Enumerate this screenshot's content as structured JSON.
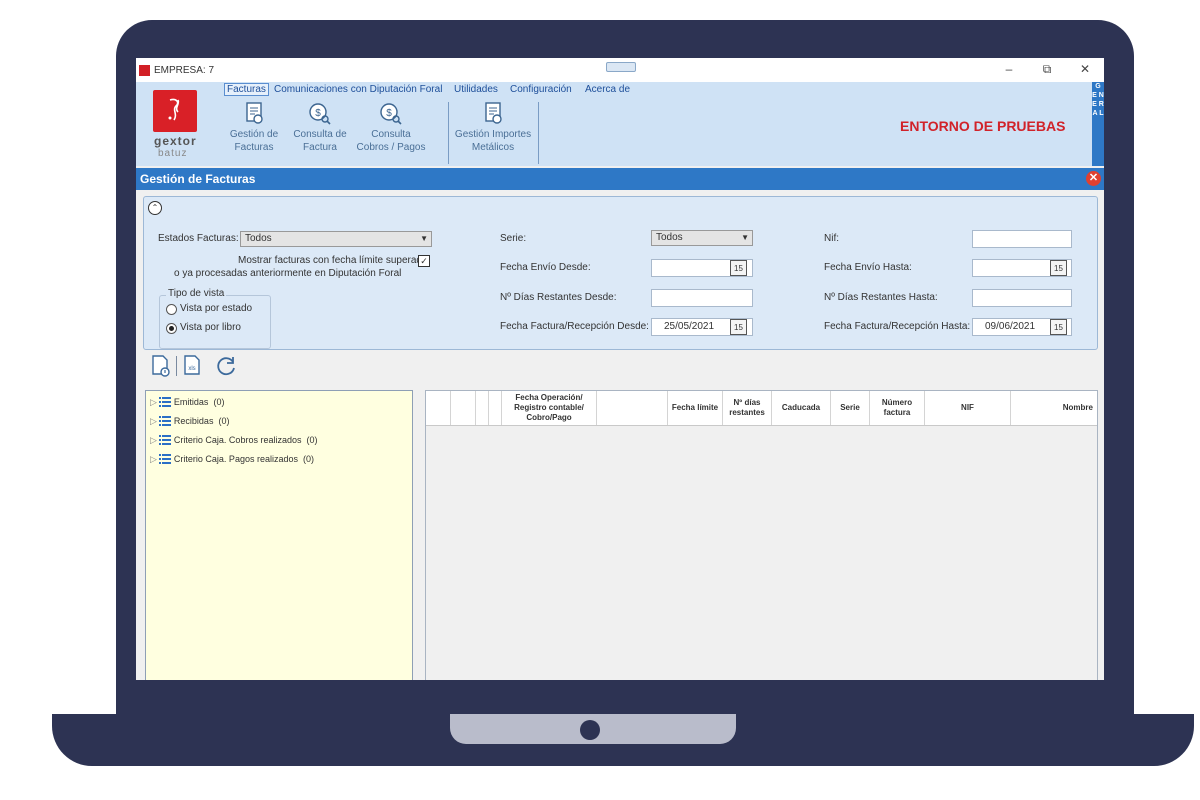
{
  "window": {
    "title": "EMPRESA: 7",
    "minimize": "–",
    "restore": "⧉",
    "close": "✕"
  },
  "logo": {
    "name": "gextor",
    "sub": "batuz"
  },
  "menu": [
    {
      "label": "Facturas"
    },
    {
      "label": "Comunicaciones con Diputación Foral"
    },
    {
      "label": "Utilidades"
    },
    {
      "label": "Configuración"
    },
    {
      "label": "Acerca de"
    }
  ],
  "ribbon": {
    "buttons": [
      {
        "line1": "Gestión de",
        "line2": "Facturas",
        "icon": "invoice-icon"
      },
      {
        "line1": "Consulta de",
        "line2": "Factura",
        "icon": "coin-search-icon"
      },
      {
        "line1": "Consulta",
        "line2": "Cobros / Pagos",
        "icon": "coin-search-icon"
      },
      {
        "line1": "Gestión Importes",
        "line2": "Metálicos",
        "icon": "invoice-icon"
      }
    ],
    "environment": "ENTORNO DE PRUEBAS",
    "side_tab": "G E N E R A L"
  },
  "section": {
    "title": "Gestión de Facturas",
    "close": "✕"
  },
  "filters": {
    "estados_label": "Estados Facturas:",
    "estados_value": "Todos",
    "mostrar_line1": "Mostrar facturas con fecha límite superada",
    "mostrar_line2": "o ya procesadas anteriormente en Diputación Foral",
    "mostrar_checked": "✓",
    "tipo_vista_label": "Tipo de vista",
    "vista_estado": "Vista por estado",
    "vista_libro": "Vista por libro",
    "serie_label": "Serie:",
    "serie_value": "Todos",
    "fecha_envio_desde_label": "Fecha Envío Desde:",
    "dias_desde_label": "Nº Días Restantes Desde:",
    "fecha_factura_desde_label": "Fecha Factura/Recepción Desde:",
    "fecha_factura_desde_value": "25/05/2021",
    "nif_label": "Nif:",
    "fecha_envio_hasta_label": "Fecha Envío Hasta:",
    "dias_hasta_label": "Nº Días Restantes Hasta:",
    "fecha_factura_hasta_label": "Fecha Factura/Recepción Hasta:",
    "fecha_factura_hasta_value": "09/06/2021",
    "calendar_day": "15"
  },
  "tree": [
    {
      "label": "Emitidas",
      "count": "(0)"
    },
    {
      "label": "Recibidas",
      "count": "(0)"
    },
    {
      "label": "Criterio Caja. Cobros realizados",
      "count": "(0)"
    },
    {
      "label": "Criterio Caja. Pagos realizados",
      "count": "(0)"
    }
  ],
  "grid": {
    "columns": {
      "fecha_operacion": "Fecha Operación/ Registro contable/ Cobro/Pago",
      "fecha_limite": "Fecha límite",
      "dias_restantes": "Nº días restantes",
      "caducada": "Caducada",
      "serie": "Serie",
      "numero_factura": "Número factura",
      "nif": "NIF",
      "nombre": "Nombre"
    }
  }
}
